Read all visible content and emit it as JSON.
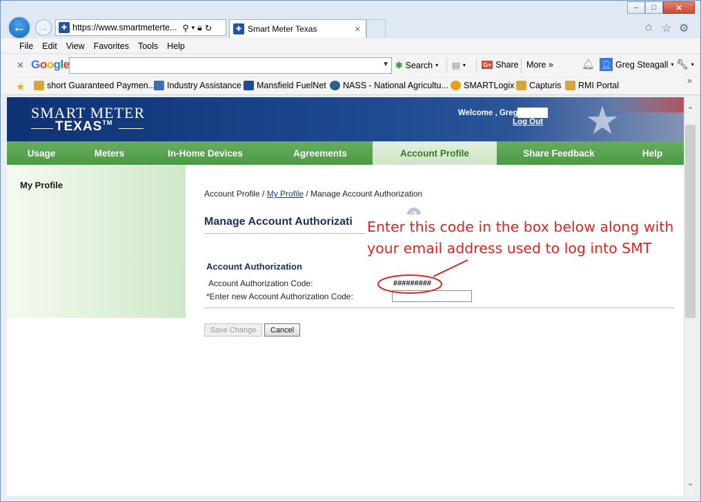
{
  "window": {
    "minimize": "–",
    "maximize": "□",
    "close": "✕"
  },
  "browser": {
    "url": "https://www.smartmeterte...",
    "tab_title": "Smart Meter Texas",
    "tab_close": "✕"
  },
  "menu": [
    "File",
    "Edit",
    "View",
    "Favorites",
    "Tools",
    "Help"
  ],
  "google_toolbar": {
    "logo": "Google",
    "search_label": "Search",
    "share_label": "Share",
    "more_label": "More »",
    "user_name": "Greg Steagall"
  },
  "favorites": [
    {
      "label": "short Guaranteed Paymen...",
      "color": "#d9a43a"
    },
    {
      "label": "Industry Assistance",
      "color": "#3b6fb6"
    },
    {
      "label": "Mansfield FuelNet",
      "color": "#1e4e9a"
    },
    {
      "label": "NASS - National Agricultu...",
      "color": "#2e5e8f"
    },
    {
      "label": "SMARTLogix",
      "color": "#e0a21a"
    },
    {
      "label": "Capturis",
      "color": "#d9a43a"
    },
    {
      "label": "RMI Portal",
      "color": "#d9a43a"
    }
  ],
  "site": {
    "logo_top": "SMART METER",
    "logo_bottom": "TEXAS",
    "logo_tm": "TM",
    "welcome": "Welcome , Greg",
    "logout": "Log Out",
    "nav": [
      "Usage",
      "Meters",
      "In-Home Devices",
      "Agreements",
      "Account Profile",
      "Share Feedback",
      "Help"
    ],
    "active_nav": "Account Profile",
    "colors": {
      "nav_green": "#4b9a44",
      "header_blue": "#0f3274",
      "title_blue": "#1a2f63"
    }
  },
  "sidebar": {
    "title": "My Profile"
  },
  "main": {
    "breadcrumb_1": "Account Profile /",
    "breadcrumb_2": "My Profile",
    "breadcrumb_3": "/ Manage Account Authorization",
    "page_title": "Manage Account Authorizati",
    "section_title": "Account Authorization",
    "code_label": "Account Authorization Code:",
    "code_value": "#########",
    "new_code_label": "*Enter new Account Authorization Code:",
    "new_code_value": "",
    "save_button": "Save Change",
    "cancel_button": "Cancel"
  },
  "annotation": {
    "line1": "Enter this code in the box below along with",
    "line2": "your email address used to log into SMT",
    "color": "#e0231e"
  }
}
